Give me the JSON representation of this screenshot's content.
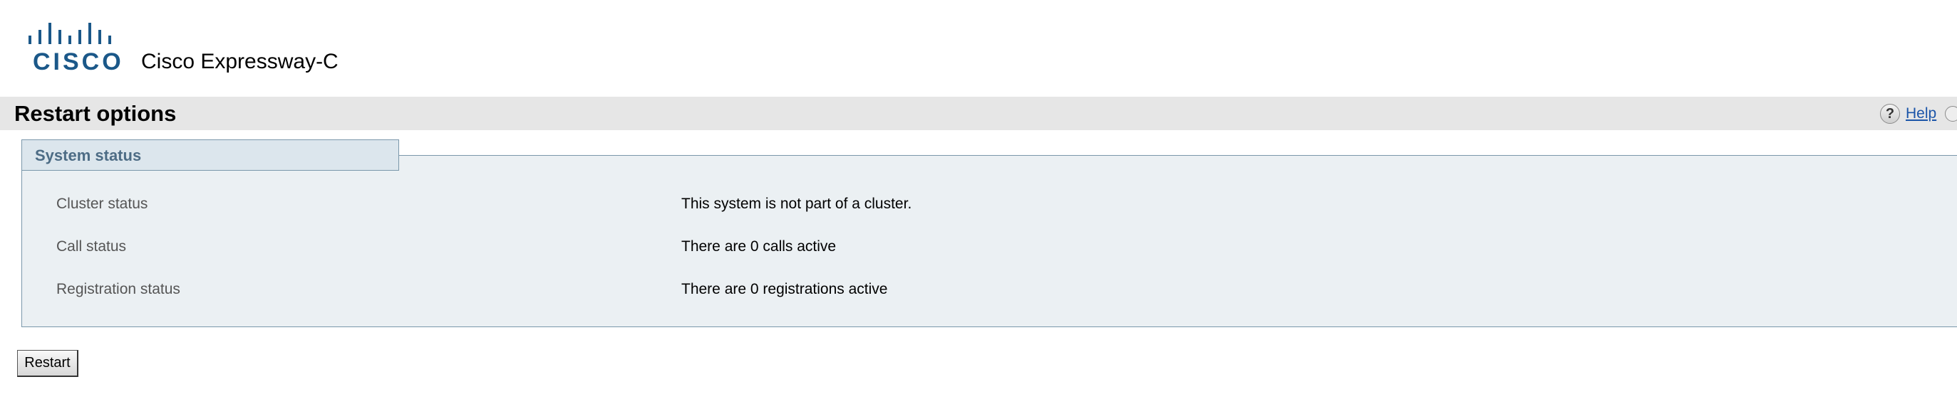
{
  "brand": {
    "logo_text": "CISCO",
    "logo_color": "#1b5889",
    "product_name": "Cisco Expressway-C"
  },
  "page": {
    "title": "Restart options",
    "help_label": "Help"
  },
  "system_status": {
    "legend": "System status",
    "rows": [
      {
        "label": "Cluster status",
        "value": "This system is not part of a cluster."
      },
      {
        "label": "Call status",
        "value": "There are 0 calls active"
      },
      {
        "label": "Registration status",
        "value": "There are 0 registrations active"
      }
    ]
  },
  "actions": {
    "restart_label": "Restart"
  },
  "icons": {
    "help": "help-icon",
    "logo": "cisco-logo-icon"
  },
  "colors": {
    "title_bar": "#e6e6e6",
    "panel_bg": "#ebf0f3",
    "panel_border": "#7a97aa",
    "legend_text": "#4d6c85",
    "link": "#1a54a8"
  }
}
